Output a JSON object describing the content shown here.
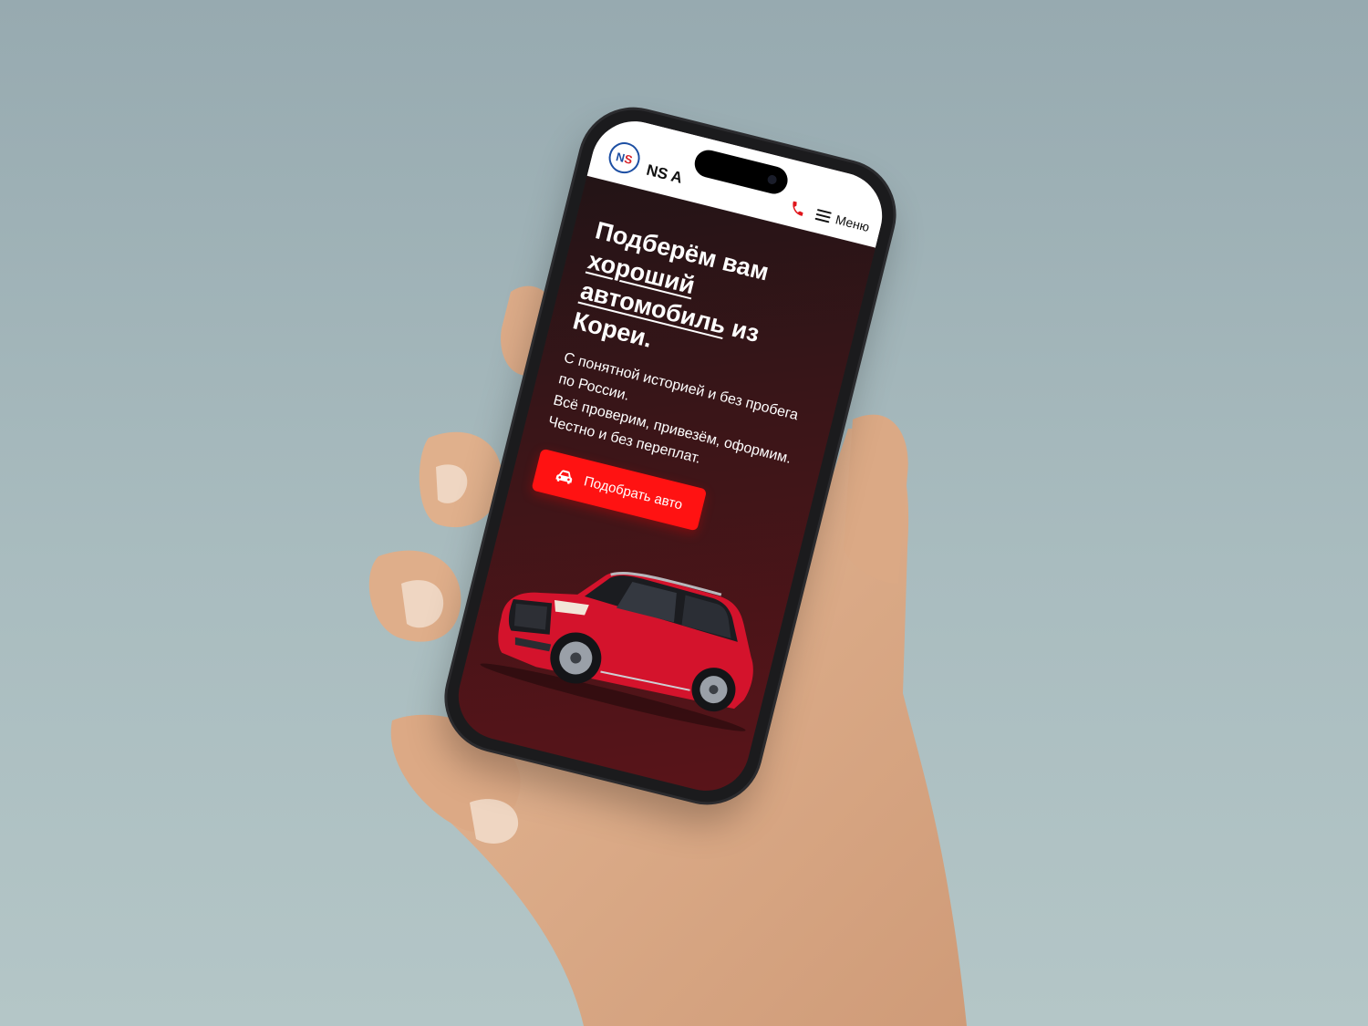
{
  "app": {
    "brand_name": "NS Auto",
    "logo_letters": {
      "n": "N",
      "s": "S"
    },
    "menu_label": "Меню"
  },
  "hero": {
    "headline_part1": "Подберём вам ",
    "headline_emph1": "хороший",
    "headline_break": " ",
    "headline_emph2": "автомобиль",
    "headline_part2": " из Кореи.",
    "description_lines": [
      "С понятной историей и без пробега по России.",
      "Всё проверим, привезём, оформим.",
      "Честно и без переплат."
    ],
    "cta_label": "Подобрать авто"
  },
  "icons": {
    "phone": "phone-icon",
    "menu": "hamburger-icon",
    "cta": "car-icon"
  },
  "colors": {
    "accent": "#ff1212",
    "logo_blue": "#1d4fa3",
    "logo_red": "#d8232a",
    "hero_bg_dark": "#1d1416",
    "hero_bg_red": "#5a1419"
  }
}
